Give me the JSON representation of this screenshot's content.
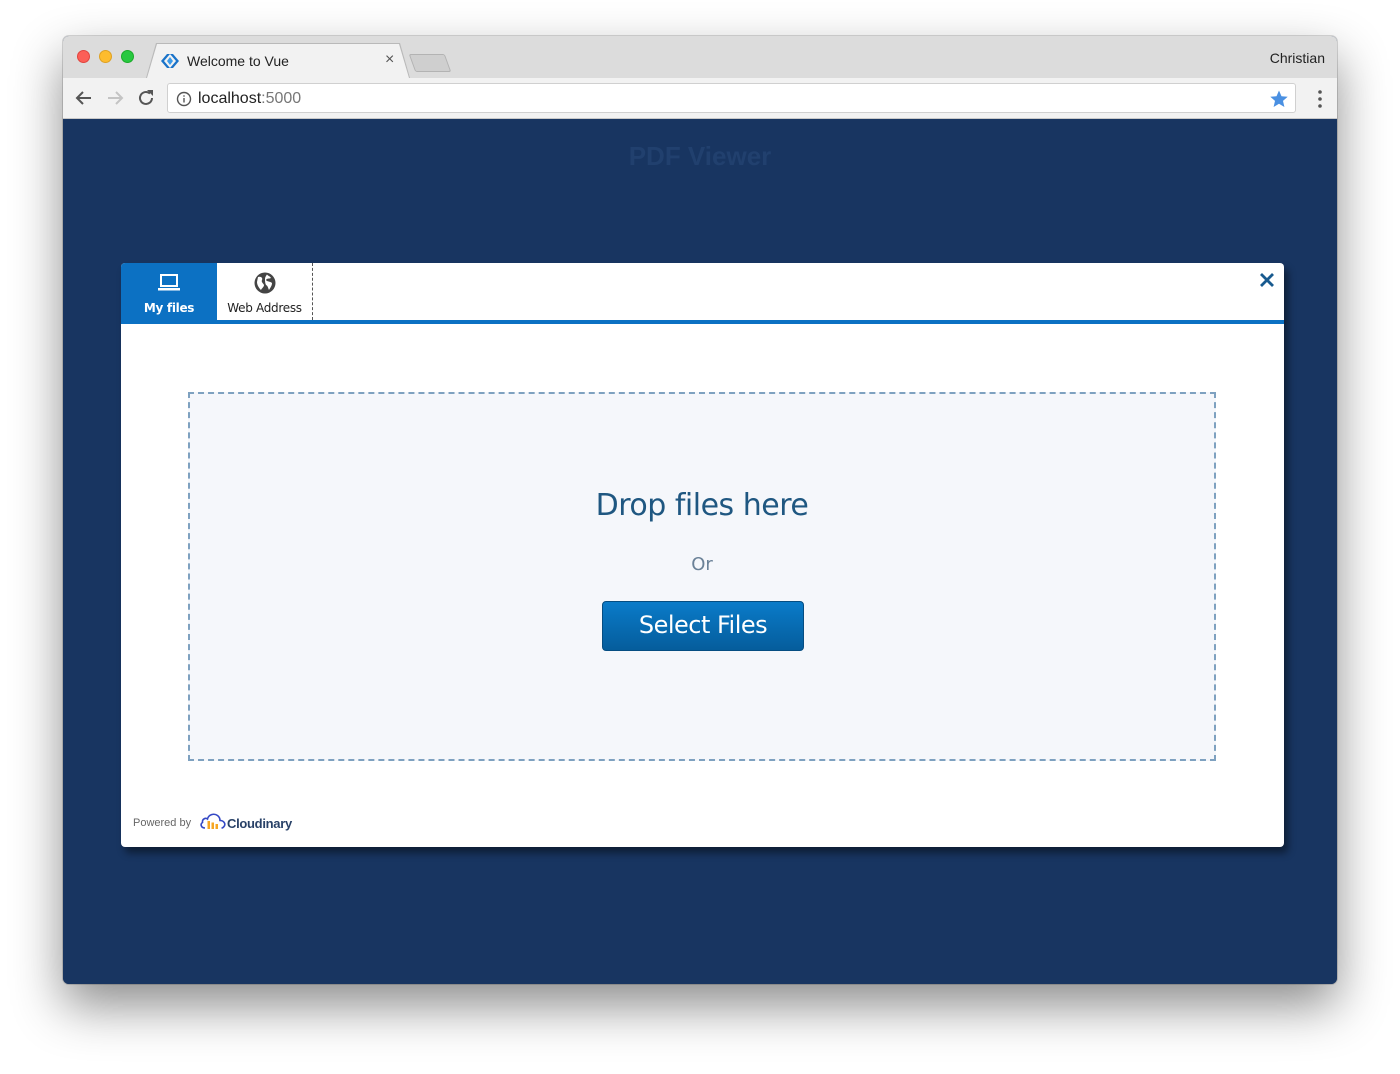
{
  "browser": {
    "tab_title": "Welcome to Vue",
    "tab_close_glyph": "×",
    "profile_name": "Christian",
    "url_host": "localhost",
    "url_port": ":5000",
    "icons": {
      "favicon": "vue-favicon-icon",
      "back": "arrow-left-icon",
      "forward": "arrow-right-icon",
      "reload": "reload-icon",
      "info": "info-icon",
      "bookmark": "star-icon",
      "menu": "kebab-menu-icon"
    },
    "colors": {
      "bookmark_star": "#4a90e2"
    }
  },
  "page": {
    "title": "PDF Viewer",
    "background_color": "#183561"
  },
  "upload_widget": {
    "tabs": [
      {
        "label": "My files",
        "icon": "laptop-icon",
        "active": true
      },
      {
        "label": "Web Address",
        "icon": "globe-icon",
        "active": false
      }
    ],
    "close_icon": "close-icon",
    "dropzone": {
      "title": "Drop files here",
      "separator": "Or",
      "button_label": "Select Files"
    },
    "footer": {
      "powered_by": "Powered by",
      "brand": "Cloudinary",
      "brand_icon": "cloudinary-logo-icon"
    },
    "colors": {
      "accent": "#0c71c3",
      "dropzone_border": "#7ea1c0",
      "title_text": "#1f5781"
    }
  }
}
